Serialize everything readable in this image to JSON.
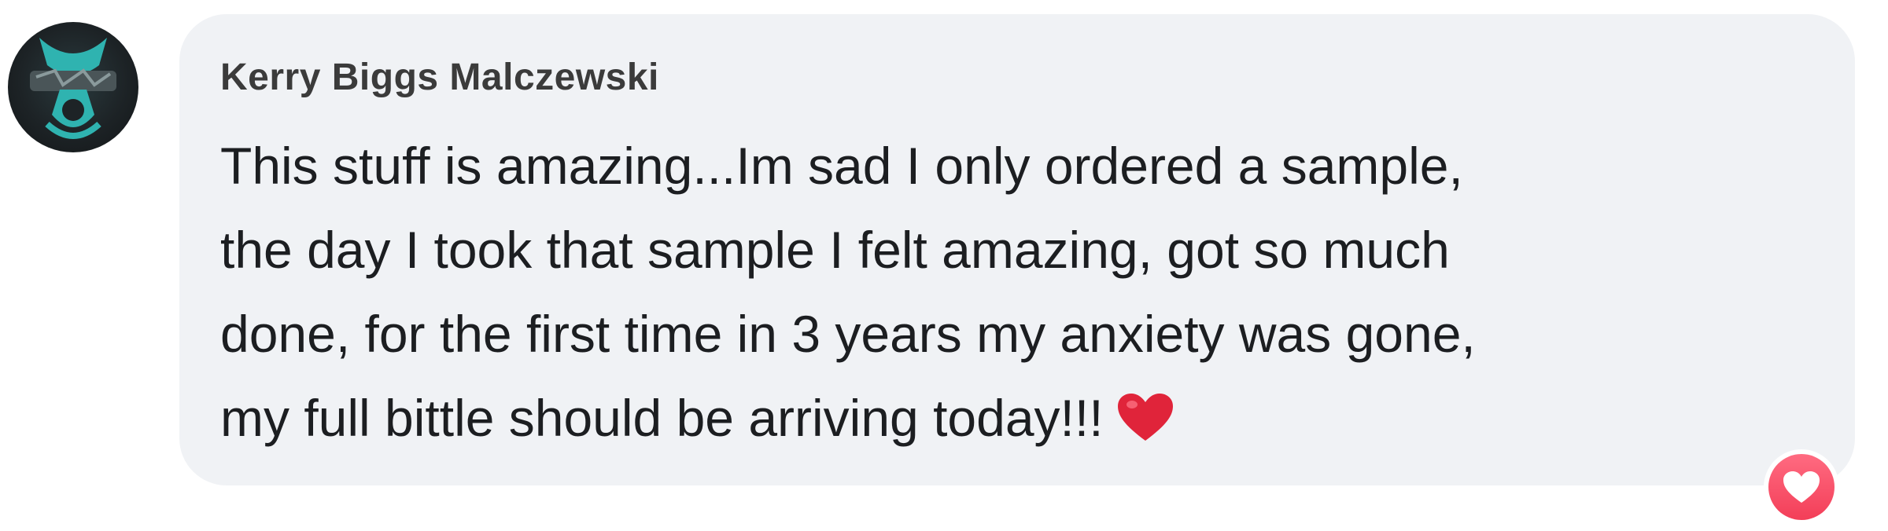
{
  "comment": {
    "author": "Kerry Biggs Malczewski",
    "lines": [
      "This stuff is amazing...Im sad I only ordered a sample,",
      "the day I took that sample I felt amazing, got so much",
      "done, for the first time in 3 years my anxiety was gone,",
      "my full bittle should be arriving today!!!"
    ],
    "emoji": "heart-emoji",
    "reaction": "love-reaction-icon"
  },
  "colors": {
    "bubble": "#f0f2f5",
    "text": "#1c1e21",
    "name": "#3b3b3b",
    "heart": "#e0243a",
    "reaction": "#f33e58",
    "avatar_accent": "#2fb3b0"
  }
}
